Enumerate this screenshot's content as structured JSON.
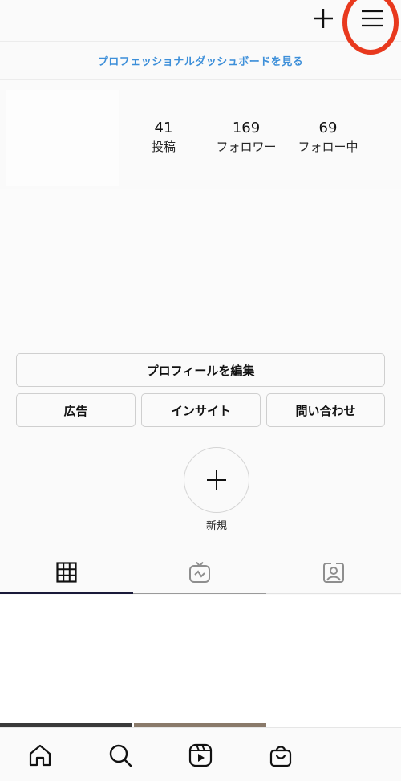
{
  "header": {
    "create_icon": "plus-icon",
    "menu_icon": "hamburger-menu-icon",
    "highlight_color": "#e8391e"
  },
  "dashboard": {
    "link_text": "プロフェッショナルダッシュボードを見る",
    "color": "#3d8fd9"
  },
  "stats": [
    {
      "value": "41",
      "label": "投稿"
    },
    {
      "value": "169",
      "label": "フォロワー"
    },
    {
      "value": "69",
      "label": "フォロー中"
    }
  ],
  "actions": {
    "edit_profile": "プロフィールを編集",
    "ads": "広告",
    "insights": "インサイト",
    "contact": "問い合わせ"
  },
  "highlight": {
    "new_label": "新規",
    "icon": "plus-icon"
  },
  "tabs": [
    {
      "name": "grid",
      "icon": "grid-icon",
      "active": true
    },
    {
      "name": "igtv",
      "icon": "igtv-icon",
      "active": false
    },
    {
      "name": "tagged",
      "icon": "tagged-person-icon",
      "active": false
    }
  ],
  "bottom_nav": [
    {
      "name": "home",
      "icon": "home-icon"
    },
    {
      "name": "search",
      "icon": "search-icon"
    },
    {
      "name": "reels",
      "icon": "reels-icon"
    },
    {
      "name": "shop",
      "icon": "shopping-bag-icon"
    }
  ]
}
